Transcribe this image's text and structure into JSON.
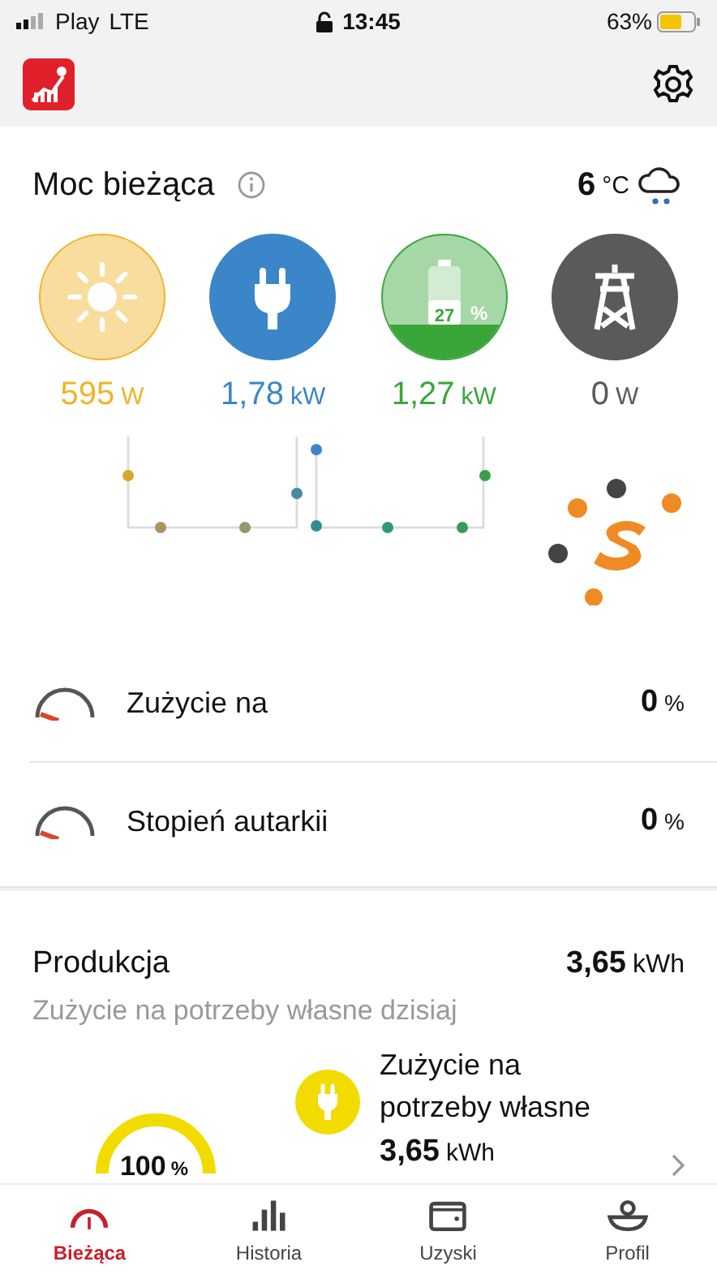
{
  "status_bar": {
    "carrier": "Play",
    "network": "LTE",
    "time": "13:45",
    "battery": "63%"
  },
  "current_power": {
    "title": "Moc bieżąca",
    "temperature": "6",
    "temperature_unit": "°C",
    "nodes": [
      {
        "kind": "solar",
        "value": "595",
        "unit": "W",
        "color": "#f0b429"
      },
      {
        "kind": "consumption",
        "value": "1,78",
        "unit": "kW",
        "color": "#3a86c8"
      },
      {
        "kind": "battery",
        "value": "1,27",
        "unit": "kW",
        "color": "#3aa63a",
        "level": 0.27,
        "badge": "27",
        "badge_unit": "%"
      },
      {
        "kind": "grid",
        "value": "0",
        "unit": "W",
        "color": "#5a5a5a"
      }
    ]
  },
  "ratios": [
    {
      "label": "Zużycie na",
      "value": "0",
      "unit": "%"
    },
    {
      "label": "Stopień autarkii",
      "value": "0",
      "unit": "%"
    }
  ],
  "production": {
    "title": "Produkcja",
    "total": "3,65",
    "total_unit": "kWh",
    "subtitle": "Zużycie na potrzeby własne dzisiaj",
    "gauge_value": "100",
    "gauge_unit": "%",
    "item_label": "Zużycie na potrzeby własne",
    "item_value": "3,65",
    "item_unit": "kWh"
  },
  "tabs": [
    {
      "label": "Bieżąca",
      "kind": "gauge",
      "selected": true
    },
    {
      "label": "Historia",
      "kind": "bars",
      "selected": false
    },
    {
      "label": "Uzyski",
      "kind": "wallet",
      "selected": false
    },
    {
      "label": "Profil",
      "kind": "person",
      "selected": false
    }
  ]
}
